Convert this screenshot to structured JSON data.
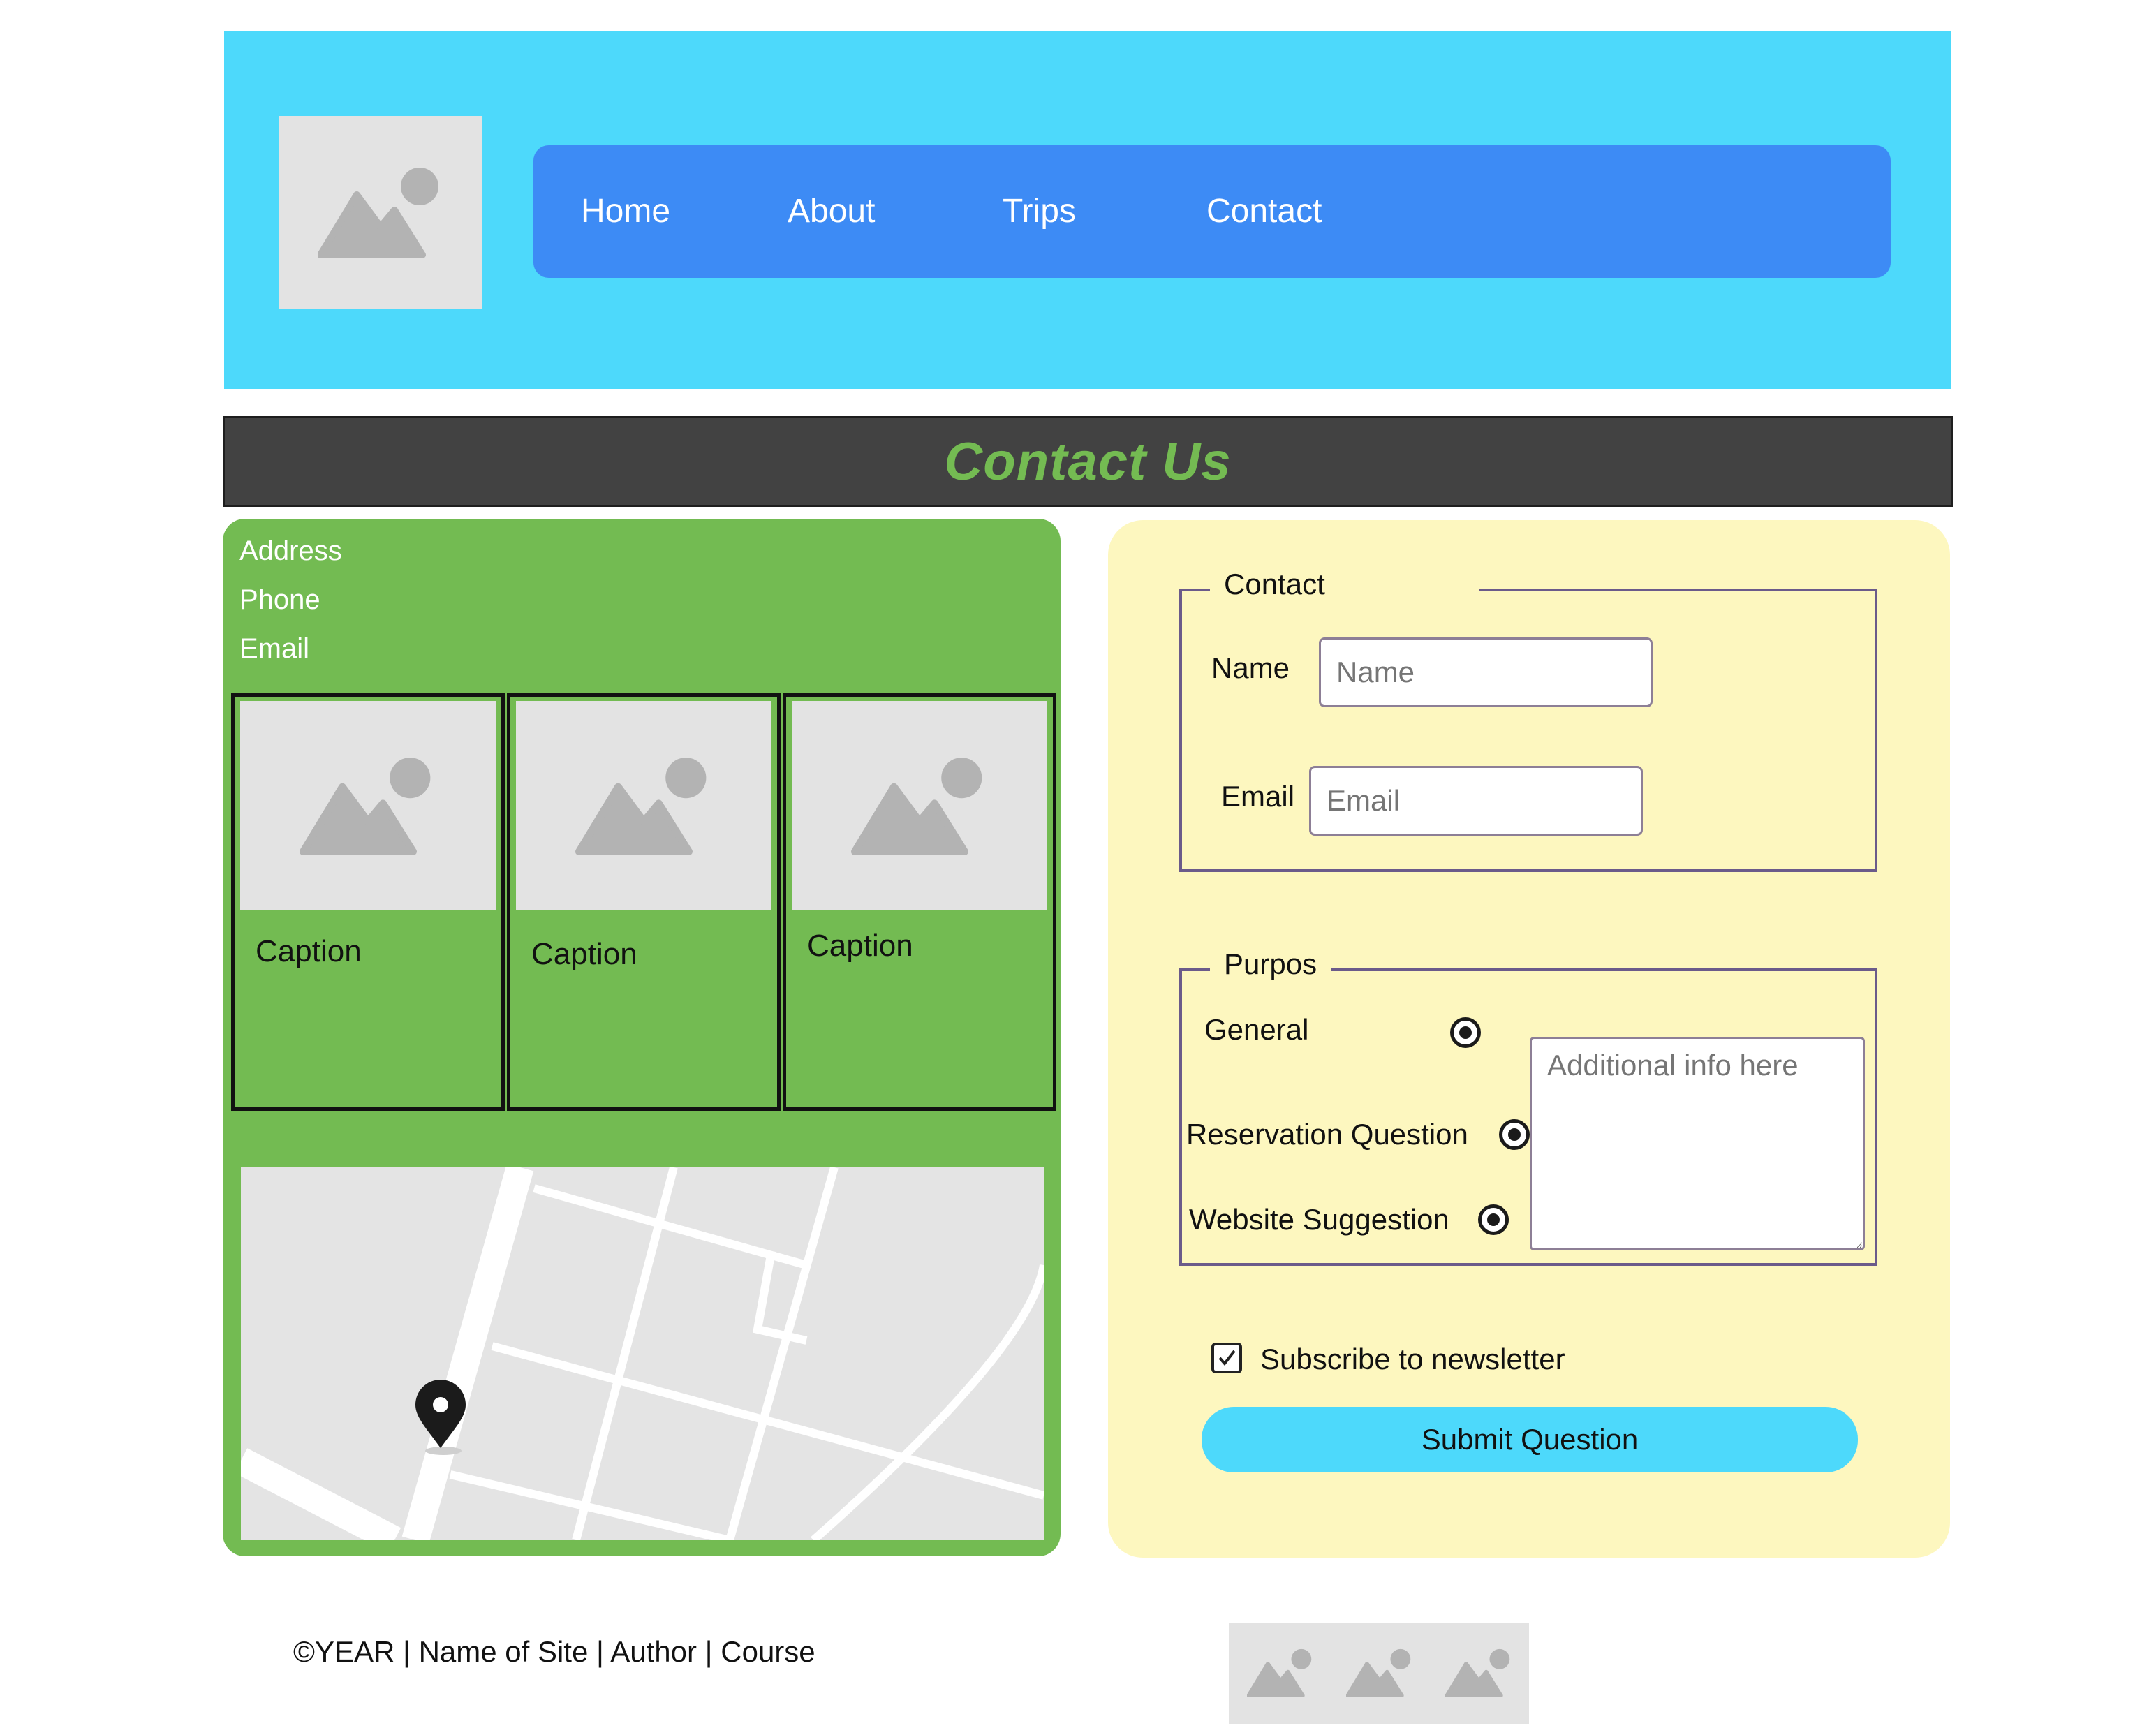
{
  "header": {
    "logo_icon": "image-placeholder-icon",
    "nav": [
      "Home",
      "About",
      "Trips",
      "Contact"
    ],
    "colors": {
      "header_bg": "#4dd9fb",
      "nav_bg": "#3d8bf5"
    }
  },
  "title": {
    "text": "Contact Us",
    "color": "#74bb52",
    "band_bg": "#424242"
  },
  "info": {
    "lines": [
      "Address",
      "Phone",
      "Email"
    ],
    "panel_color": "#73bb52",
    "cards": [
      {
        "caption": "Caption"
      },
      {
        "caption": "Caption"
      },
      {
        "caption": "Caption"
      }
    ],
    "map_icon": "map-pin-icon"
  },
  "form": {
    "panel_color": "#fdf7bf",
    "contact_fieldset": {
      "legend": "Contact",
      "name_label": "Name",
      "name_placeholder": "Name",
      "email_label": "Email",
      "email_placeholder": "Email"
    },
    "purpose_fieldset": {
      "legend": "Purpos",
      "options": [
        "General",
        "Reservation Question",
        "Website Suggestion"
      ],
      "textarea_placeholder": "Additional info here"
    },
    "newsletter_label": "Subscribe to newsletter",
    "newsletter_checked": true,
    "submit_label": "Submit Question",
    "submit_color": "#4dd9fb"
  },
  "footer": {
    "text": "©YEAR | Name of Site | Author | Course",
    "icons": [
      "image-placeholder-icon",
      "image-placeholder-icon",
      "image-placeholder-icon"
    ]
  }
}
